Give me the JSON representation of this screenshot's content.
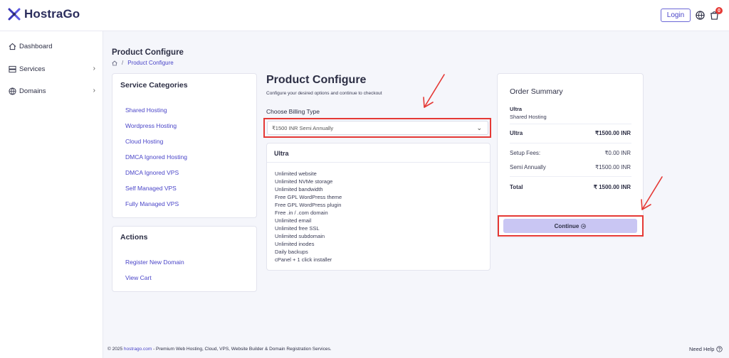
{
  "header": {
    "brand": "HostraGo",
    "login_label": "Login",
    "cart_count": "0"
  },
  "sidebar": {
    "items": [
      {
        "label": "Dashboard",
        "icon": "home-icon"
      },
      {
        "label": "Services",
        "icon": "server-icon"
      },
      {
        "label": "Domains",
        "icon": "globe-icon"
      }
    ]
  },
  "page": {
    "title": "Product Configure",
    "breadcrumb_current": "Product Configure"
  },
  "service_categories": {
    "title": "Service Categories",
    "items": [
      "Shared Hosting",
      "Wordpress Hosting",
      "Cloud Hosting",
      "DMCA Ignored Hosting",
      "DMCA Ignored VPS",
      "Self Managed VPS",
      "Fully Managed VPS"
    ]
  },
  "actions": {
    "title": "Actions",
    "items": [
      "Register New Domain",
      "View Cart"
    ]
  },
  "configure": {
    "title": "Product Configure",
    "subtitle": "Configure your desired options and continue to checkout",
    "billing_label": "Choose Billing Type",
    "billing_selected": "₹1500 INR Semi Annually",
    "plan_name": "Ultra",
    "features": [
      "Unlimited website",
      "Unlimited NVMe storage",
      "Unlimited bandwidth",
      "Free GPL WordPress theme",
      "Free GPL WordPress plugin",
      "Free .in / .com domain",
      "Unlimited email",
      "Unlimited free SSL",
      "Unlimited subdomain",
      "Unlimited inodes",
      "Daily backups",
      "cPanel + 1 click installer"
    ]
  },
  "order_summary": {
    "title": "Order Summary",
    "product_name": "Ultra",
    "product_group": "Shared Hosting",
    "price_label": "Ultra",
    "price_value": "₹1500.00 INR",
    "setup_label": "Setup Fees:",
    "setup_value": "₹0.00 INR",
    "cycle_label": "Semi Annually",
    "cycle_value": "₹1500.00 INR",
    "total_label": "Total",
    "total_value": "₹ 1500.00 INR",
    "continue_label": "Continue"
  },
  "footer": {
    "prefix": "© 2025 ",
    "site": "hostrago.com",
    "suffix": " - Premium Web Hosting, Cloud, VPS, Website Builder & Domain Registration Services.",
    "help": "Need Help"
  },
  "colors": {
    "accent": "#4a45c8",
    "highlight": "#e53935",
    "button": "#c9c6f3"
  }
}
